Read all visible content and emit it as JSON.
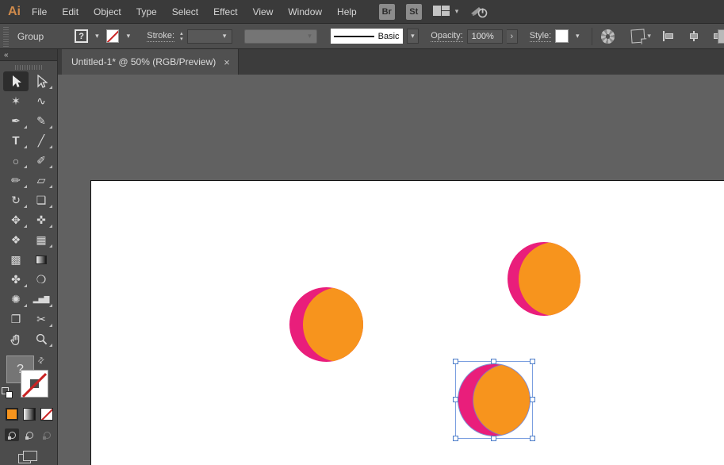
{
  "app": {
    "logo_label": "Ai",
    "menu": [
      "File",
      "Edit",
      "Object",
      "Type",
      "Select",
      "Effect",
      "View",
      "Window",
      "Help"
    ],
    "bridge_button": "Br",
    "stock_button": "St"
  },
  "control_bar": {
    "context_label": "Group",
    "fill_value": "?",
    "stroke_label": "Stroke:",
    "stroke_weight_value": "",
    "brush_definition_value": "Basic",
    "opacity_label": "Opacity:",
    "opacity_value": "100%",
    "opacity_expand_glyph": "›",
    "style_label": "Style:"
  },
  "document_tab": {
    "title": "Untitled-1* @ 50% (RGB/Preview)",
    "close_glyph": "×"
  },
  "toolbar": {
    "collapse_glyph": "«",
    "fill_proxy_value": "?",
    "swap_glyph": "⇄",
    "tools": [
      {
        "name": "selection",
        "glyph": ""
      },
      {
        "name": "direct-selection",
        "glyph": ""
      },
      {
        "name": "magic-wand",
        "glyph": "✶"
      },
      {
        "name": "lasso",
        "glyph": "∿"
      },
      {
        "name": "pen",
        "glyph": "✒"
      },
      {
        "name": "curvature",
        "glyph": "✎"
      },
      {
        "name": "type",
        "glyph": "T"
      },
      {
        "name": "line-segment",
        "glyph": "╱"
      },
      {
        "name": "ellipse",
        "glyph": "○"
      },
      {
        "name": "paintbrush",
        "glyph": "✐"
      },
      {
        "name": "shaper",
        "glyph": "✏"
      },
      {
        "name": "eraser",
        "glyph": "▱"
      },
      {
        "name": "rotate",
        "glyph": "↻"
      },
      {
        "name": "scale",
        "glyph": "❏"
      },
      {
        "name": "width",
        "glyph": "✥"
      },
      {
        "name": "puppet-warp",
        "glyph": "✜"
      },
      {
        "name": "shape-builder",
        "glyph": "❖"
      },
      {
        "name": "perspective-grid",
        "glyph": "▦"
      },
      {
        "name": "mesh",
        "glyph": "▩"
      },
      {
        "name": "gradient",
        "glyph": ""
      },
      {
        "name": "eyedropper",
        "glyph": "✤"
      },
      {
        "name": "blend",
        "glyph": "❍"
      },
      {
        "name": "symbol-sprayer",
        "glyph": "✺"
      },
      {
        "name": "column-graph",
        "glyph": "▂▅▇"
      },
      {
        "name": "artboard",
        "glyph": "❐"
      },
      {
        "name": "slice",
        "glyph": "✂"
      },
      {
        "name": "hand",
        "glyph": ""
      },
      {
        "name": "zoom",
        "glyph": ""
      }
    ]
  },
  "canvas": {
    "artboard_color": "#FFFFFF",
    "objects": [
      {
        "name": "circle-top-right",
        "fill_main": "#F7941D",
        "fill_crescent": "#E91E7B",
        "selected": false
      },
      {
        "name": "circle-middle-left",
        "fill_main": "#F7941D",
        "fill_crescent": "#E91E7B",
        "selected": false
      },
      {
        "name": "circle-bottom",
        "fill_main": "#F7941D",
        "fill_crescent": "#E91E7B",
        "selected": true
      }
    ]
  },
  "colors": {
    "moon-orange": "#F7941D",
    "moon-pink": "#E91E7B",
    "selection-blue": "#6E8CD2",
    "menubar-bg": "#3A3A3A",
    "controlbar-bg": "#4E4E4E",
    "panel-bg": "#4C4C4C",
    "tabstrip-bg": "#3C3C3C",
    "pasteboard": "#616161",
    "logo-orange": "#CF8A4B",
    "none-red": "#C92222"
  }
}
